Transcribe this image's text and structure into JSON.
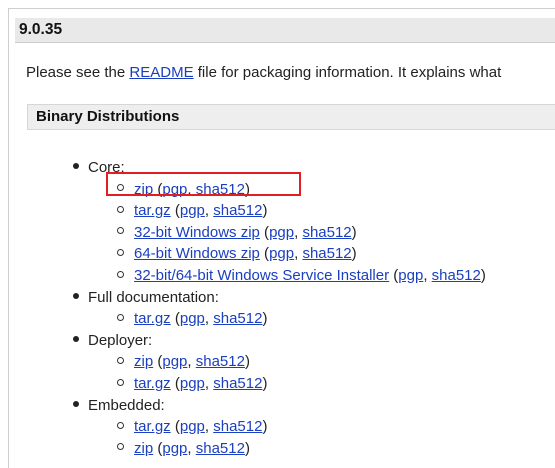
{
  "version_header": "9.0.35",
  "intro": {
    "before": "Please see the ",
    "readme_link": "README",
    "after": " file for packaging information. It explains what"
  },
  "section_title": "Binary Distributions",
  "groups": [
    {
      "label": "Core:",
      "items": [
        {
          "name": "zip",
          "pgp": "pgp",
          "sha": "sha512"
        },
        {
          "name": "tar.gz",
          "pgp": "pgp",
          "sha": "sha512"
        },
        {
          "name": "32-bit Windows zip",
          "pgp": "pgp",
          "sha": "sha512"
        },
        {
          "name": "64-bit Windows zip",
          "pgp": "pgp",
          "sha": "sha512"
        },
        {
          "name": "32-bit/64-bit Windows Service Installer",
          "pgp": "pgp",
          "sha": "sha512"
        }
      ]
    },
    {
      "label": "Full documentation:",
      "items": [
        {
          "name": "tar.gz",
          "pgp": "pgp",
          "sha": "sha512"
        }
      ]
    },
    {
      "label": "Deployer:",
      "items": [
        {
          "name": "zip",
          "pgp": "pgp",
          "sha": "sha512"
        },
        {
          "name": "tar.gz",
          "pgp": "pgp",
          "sha": "sha512"
        }
      ]
    },
    {
      "label": "Embedded:",
      "items": [
        {
          "name": "tar.gz",
          "pgp": "pgp",
          "sha": "sha512"
        },
        {
          "name": "zip",
          "pgp": "pgp",
          "sha": "sha512"
        }
      ]
    }
  ],
  "punct": {
    "open": " (",
    "comma": ", ",
    "close": ")"
  },
  "colors": {
    "link": "#1a3fbf",
    "highlight_border": "#e02020",
    "header_bg": "#e9e9e9"
  }
}
